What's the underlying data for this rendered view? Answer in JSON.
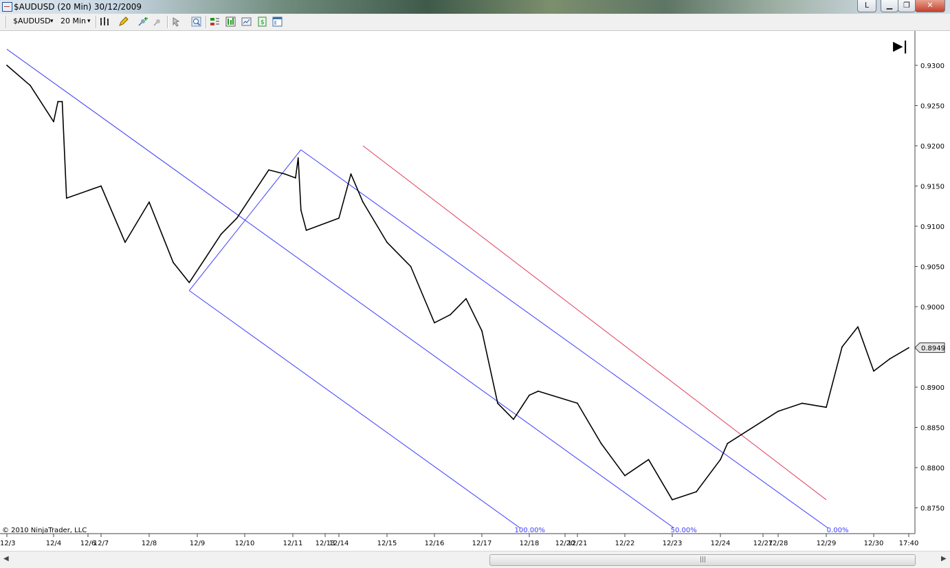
{
  "window": {
    "title": "$AUDUSD (20 Min)  30/12/2009",
    "buttons": [
      "L",
      "▁",
      "❐",
      "✕"
    ]
  },
  "toolbar": {
    "instrument": "$AUDUSD",
    "interval": "20 Min",
    "dropdown_arrow": "▾"
  },
  "icons": [
    "bar-type-icon",
    "pencil-draw-icon",
    "add-indicator-icon",
    "strategy-icon",
    "pointer-icon",
    "zoom-icon",
    "chart-trader-icon",
    "data-box-icon",
    "properties-icon",
    "snapshot-icon",
    "new-window-icon"
  ],
  "copyright": "© 2010 NinjaTrader, LLC",
  "scroll_end_glyph": "▶|",
  "colors": {
    "price": "#000000",
    "channel": "#3c3cff",
    "red_line": "#e03c5a",
    "fib_label": "#3c3cff"
  },
  "chart_data": {
    "type": "line",
    "title": "",
    "instrument": "$AUDUSD",
    "interval": "20 Min",
    "ylim": [
      0.873,
      0.932
    ],
    "y_ticks": [
      "0.9300",
      "0.9250",
      "0.9200",
      "0.9150",
      "0.9100",
      "0.9050",
      "0.9000",
      "0.8950",
      "0.8900",
      "0.8850",
      "0.8800",
      "0.8750"
    ],
    "x_ticks": [
      "12/3",
      "12/4",
      "12/6",
      "12/7",
      "12/8",
      "12/9",
      "12/10",
      "12/11",
      "12/13",
      "12/14",
      "12/15",
      "12/16",
      "12/17",
      "12/18",
      "12/20",
      "12/21",
      "12/22",
      "12/23",
      "12/24",
      "12/27",
      "12/28",
      "12/29",
      "12/30",
      "17:40"
    ],
    "last_price": "0.8949",
    "series": [
      {
        "x": [
          "12/3 00:00",
          "12/3 12:00",
          "12/4 00:00",
          "12/4 06:00",
          "12/4 12:00",
          "12/4 18:00",
          "12/7 00:00",
          "12/7 12:00",
          "12/8 00:00",
          "12/8 12:00",
          "12/8 20:00",
          "12/9 04:00",
          "12/9 12:00",
          "12/9 20:00",
          "12/10 04:00",
          "12/10 12:00",
          "12/10 20:00",
          "12/11 04:00",
          "12/11 08:00",
          "12/11 12:00",
          "12/11 20:00",
          "12/14 00:00",
          "12/14 06:00",
          "12/14 12:00",
          "12/15 00:00",
          "12/15 12:00",
          "12/16 00:00",
          "12/16 08:00",
          "12/16 16:00",
          "12/17 00:00",
          "12/17 08:00",
          "12/17 16:00",
          "12/18 00:00",
          "12/18 12:00",
          "12/21 00:00",
          "12/21 12:00",
          "12/22 00:00",
          "12/22 12:00",
          "12/23 00:00",
          "12/23 12:00",
          "12/24 00:00",
          "12/24 12:00",
          "12/28 00:00",
          "12/28 12:00",
          "12/29 00:00",
          "12/29 08:00",
          "12/29 16:00",
          "12/30 00:00",
          "12/30 08:00",
          "12/30 17:40"
        ],
        "values": [
          0.93,
          0.9275,
          0.923,
          0.9255,
          0.9255,
          0.9135,
          0.915,
          0.908,
          0.913,
          0.9055,
          0.903,
          0.906,
          0.909,
          0.911,
          0.914,
          0.917,
          0.9165,
          0.916,
          0.9185,
          0.912,
          0.9095,
          0.911,
          0.9165,
          0.913,
          0.908,
          0.905,
          0.898,
          0.899,
          0.901,
          0.897,
          0.888,
          0.886,
          0.889,
          0.8895,
          0.888,
          0.883,
          0.879,
          0.881,
          0.876,
          0.877,
          0.881,
          0.883,
          0.887,
          0.888,
          0.8875,
          0.895,
          0.8975,
          0.892,
          0.8935,
          0.8949
        ]
      }
    ],
    "drawings": {
      "andrews_pitchfork": {
        "pivot_points": [
          {
            "x": "12/3 00:00",
            "y": 0.932
          },
          {
            "x": "12/8 20:00",
            "y": 0.902
          },
          {
            "x": "12/11 12:00",
            "y": 0.9195
          }
        ],
        "levels": [
          "100.00%",
          "50.00%",
          "0.00%"
        ]
      },
      "parallel_line": {
        "color": "red",
        "from": {
          "x": "12/14 12:00",
          "y": 0.92
        },
        "to": {
          "x": "12/29 00:00",
          "y": 0.876
        }
      }
    }
  }
}
